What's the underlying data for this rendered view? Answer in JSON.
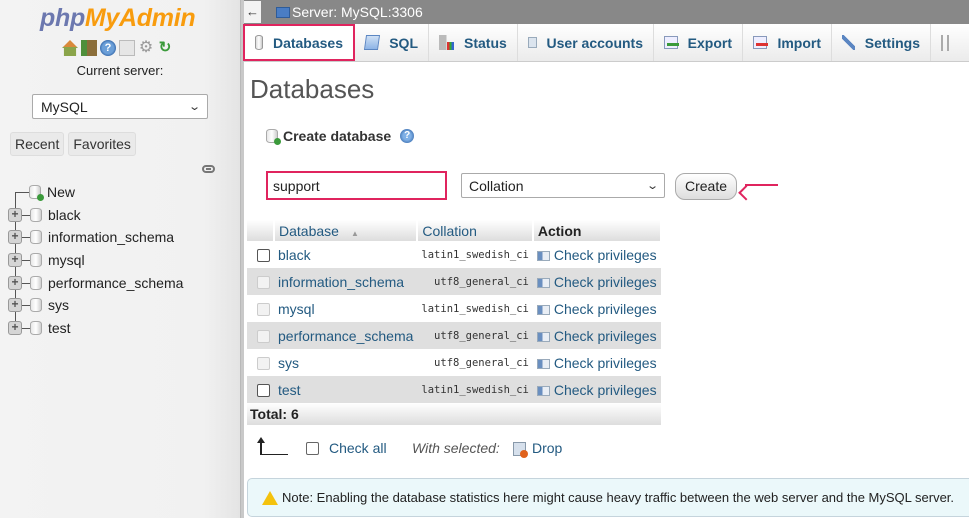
{
  "sidebar": {
    "logo": {
      "part1": "php",
      "part2": "MyAdmin"
    },
    "quick_icons": [
      "home-icon",
      "logout-icon",
      "help-icon",
      "docs-icon",
      "settings-gear-icon",
      "reload-icon"
    ],
    "current_server_label": "Current server:",
    "server_select": {
      "selected": "MySQL"
    },
    "recent_label": "Recent",
    "favorites_label": "Favorites",
    "tree": [
      {
        "label": "New",
        "type": "new"
      },
      {
        "label": "black",
        "type": "db"
      },
      {
        "label": "information_schema",
        "type": "db"
      },
      {
        "label": "mysql",
        "type": "db"
      },
      {
        "label": "performance_schema",
        "type": "db"
      },
      {
        "label": "sys",
        "type": "db"
      },
      {
        "label": "test",
        "type": "db"
      }
    ]
  },
  "topbar": {
    "back_label": "←",
    "server_title": "Server: MySQL:3306"
  },
  "tabs": [
    {
      "label": "Databases",
      "icon": "database-icon",
      "active": true
    },
    {
      "label": "SQL",
      "icon": "sql-icon"
    },
    {
      "label": "Status",
      "icon": "status-icon"
    },
    {
      "label": "User accounts",
      "icon": "user-accounts-icon"
    },
    {
      "label": "Export",
      "icon": "export-icon"
    },
    {
      "label": "Import",
      "icon": "import-icon"
    },
    {
      "label": "Settings",
      "icon": "settings-wrench-icon"
    },
    {
      "label": "",
      "icon": "more-icon"
    }
  ],
  "main": {
    "title": "Databases",
    "create_database_label": "Create database",
    "db_name_input": {
      "value": "support"
    },
    "collation_select": {
      "selected": "Collation"
    },
    "create_button": "Create",
    "accent_color": "#e0245e"
  },
  "table": {
    "headers": {
      "database": "Database",
      "collation": "Collation",
      "action": "Action"
    },
    "rows": [
      {
        "name": "black",
        "collation": "latin1_swedish_ci",
        "action": "Check privileges",
        "checkbox_enabled": true
      },
      {
        "name": "information_schema",
        "collation": "utf8_general_ci",
        "action": "Check privileges",
        "checkbox_enabled": false
      },
      {
        "name": "mysql",
        "collation": "latin1_swedish_ci",
        "action": "Check privileges",
        "checkbox_enabled": false
      },
      {
        "name": "performance_schema",
        "collation": "utf8_general_ci",
        "action": "Check privileges",
        "checkbox_enabled": false
      },
      {
        "name": "sys",
        "collation": "utf8_general_ci",
        "action": "Check privileges",
        "checkbox_enabled": false
      },
      {
        "name": "test",
        "collation": "latin1_swedish_ci",
        "action": "Check privileges",
        "checkbox_enabled": true
      }
    ],
    "total_label": "Total: 6"
  },
  "bulk": {
    "check_all": "Check all",
    "with_selected": "With selected:",
    "drop": "Drop"
  },
  "notice": {
    "text": "Note: Enabling the database statistics here might cause heavy traffic between the web server and the MySQL server."
  }
}
